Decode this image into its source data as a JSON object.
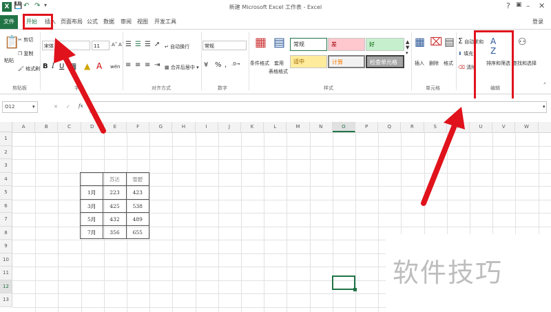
{
  "app": {
    "window_title": "新建 Microsoft Excel 工作表 - Excel",
    "help": "?",
    "login": "登录",
    "window_buttons": [
      "–",
      "□",
      "✕"
    ]
  },
  "tabs": [
    {
      "label": "文件"
    },
    {
      "label": "开始"
    },
    {
      "label": "插入"
    },
    {
      "label": "页面布局"
    },
    {
      "label": "公式"
    },
    {
      "label": "数据"
    },
    {
      "label": "审阅"
    },
    {
      "label": "视图"
    },
    {
      "label": "开发工具"
    }
  ],
  "ribbon": {
    "clipboard": {
      "paste": "粘贴",
      "cut": "剪切",
      "copy": "复制",
      "format_painter": "格式刷",
      "group": "剪贴板"
    },
    "font": {
      "name": "宋体",
      "size": "11",
      "group": "字体",
      "bold": "B",
      "italic": "I",
      "underline": "U",
      "phonetic": "wén"
    },
    "alignment": {
      "wrap": "自动换行",
      "merge": "合并后居中",
      "group": "对齐方式"
    },
    "number": {
      "format": "常规",
      "percent": "%",
      "comma": ",",
      "group": "数字"
    },
    "styles": {
      "conditional": "条件格式",
      "table_format_1": "套用",
      "table_format_2": "表格格式",
      "cells": [
        "常规",
        "差",
        "好",
        "适中",
        "计算",
        "检查单元格"
      ],
      "group": "样式"
    },
    "cells": {
      "insert": "插入",
      "delete": "删除",
      "format": "格式",
      "group": "单元格"
    },
    "editing": {
      "autosum": "自动求和",
      "fill": "填充",
      "clear": "清除",
      "sort_filter": "排序和筛选",
      "find": "查找和选择",
      "group": "编辑"
    }
  },
  "formula_bar": {
    "name_box": "O12",
    "cancel": "✕",
    "enter": "✓",
    "fx": "fx"
  },
  "columns": [
    "A",
    "B",
    "C",
    "D",
    "E",
    "F",
    "G",
    "H",
    "I",
    "J",
    "K",
    "L",
    "M",
    "N",
    "O",
    "P",
    "Q",
    "R",
    "S",
    "T",
    "U",
    "V",
    "W"
  ],
  "rows": [
    "1",
    "2",
    "3",
    "4",
    "5",
    "6",
    "7",
    "8",
    "9",
    "10",
    "11",
    "12",
    "13"
  ],
  "table": {
    "headers": [
      "",
      "苏达",
      "雪碧"
    ],
    "rows": [
      [
        "1月",
        "223",
        "423"
      ],
      [
        "3月",
        "425",
        "538"
      ],
      [
        "5月",
        "432",
        "489"
      ],
      [
        "7月",
        "356",
        "655"
      ]
    ]
  },
  "selected_cell": "O12",
  "watermark": "软件技巧",
  "colors": {
    "excel_green": "#217346",
    "annotation_red": "#e0121b"
  }
}
